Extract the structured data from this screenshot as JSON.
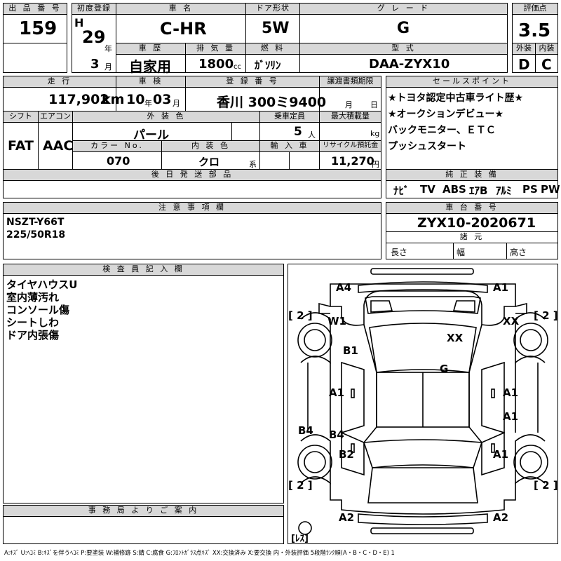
{
  "header": {
    "lot_no_label": "出 品 番 号",
    "lot_no": "159",
    "first_reg_label": "初度登録",
    "era": "H",
    "year": "29",
    "year_unit": "年",
    "month": "3",
    "month_unit": "月",
    "car_name_label": "車 名",
    "car_name": "C-HR",
    "door_label": "ドア形状",
    "door": "5W",
    "grade_label": "グ レ ー ド",
    "grade": "G",
    "score_label": "評価点",
    "score": "3.5",
    "history_label": "車 歴",
    "history": "自家用",
    "displacement_label": "排 気 量",
    "displacement": "1800",
    "displacement_unit": "cc",
    "fuel_label": "燃 料",
    "fuel": "ｶﾞｿﾘﾝ",
    "model_label": "型 式",
    "model": "DAA-ZYX10",
    "ext_label": "外装",
    "ext": "D",
    "int_label": "内装",
    "int": "C"
  },
  "row2": {
    "mileage_label": "走 行",
    "mileage": "117,902",
    "mileage_unit": "km",
    "inspection_label": "車 検",
    "insp_year": "10",
    "insp_year_unit": "年",
    "insp_month": "03",
    "insp_month_unit": "月",
    "plate_label": "登 録 番 号",
    "plate": "香川 300ミ9400",
    "transfer_label": "譲渡書類期限",
    "transfer_month": "月",
    "transfer_day": "日",
    "shift_label": "シフト",
    "shift": "FAT",
    "ac_label": "エアコン",
    "ac": "AAC",
    "color_label": "外 装 色",
    "color": "パール",
    "capacity_label": "乗車定員",
    "capacity": "5",
    "capacity_unit": "人",
    "load_label": "最大積載量",
    "load_unit": "kg",
    "color_no_label": "カラー No.",
    "color_no": "070",
    "int_color_label": "内 装 色",
    "int_color": "クロ",
    "int_color_unit": "系",
    "import_label": "輸 入 車",
    "recycle_label": "リサイクル預託金",
    "recycle": "11,270",
    "recycle_unit": "円",
    "later_label": "後 日 発 送 部 品"
  },
  "sales": {
    "label": "セールスポイント",
    "items": [
      "★トヨタ認定中古車ライト歴★",
      "★オークションデビュー★",
      "バックモニター、ＥＴＣ",
      "プッシュスタート"
    ]
  },
  "equipment": {
    "label": "純 正 装 備",
    "items": [
      "ﾅﾋﾞ",
      "TV",
      "ABS",
      "ｴｱB",
      "ｱﾙﾐ",
      "PS",
      "PW"
    ]
  },
  "notes": {
    "label": "注 意 事 項 欄",
    "lines": [
      "NSZT-Y66T",
      "225/50R18"
    ]
  },
  "chassis": {
    "label": "車 台 番 号",
    "number": "ZYX10-2020671",
    "dims_label": "諸 元",
    "length": "長さ",
    "width": "幅",
    "height": "高さ"
  },
  "inspector": {
    "label": "検 査 員 記 入 欄",
    "lines": [
      "タイヤハウスU",
      "室内薄汚れ",
      "コンソール傷",
      "シートしわ",
      "ドア内張傷"
    ]
  },
  "office": {
    "label": "事 務 局 よ り ご 案 内"
  },
  "diagram": {
    "marks": {
      "a4": "A4",
      "a1_top": "A1",
      "w1": "W1",
      "xx_right": "XX",
      "xx_center": "XX",
      "b1": "B1",
      "g": "G",
      "a1_left": "A1",
      "a1_right": "A1",
      "a1_mid_right": "A1",
      "b4_left": "B4",
      "b4_inner": "B4",
      "b2": "B2",
      "a1_low_right": "A1",
      "a2_left": "A2",
      "a2_right": "A2"
    },
    "tire_tl": "[ 2 ]",
    "tire_tr": "[ 2 ]",
    "tire_bl": "[ 2 ]",
    "tire_br": "[ 2 ]",
    "spare": "[ﾚｽ]"
  },
  "legend": "A:ｷｽﾞ U:ﾍｺﾐ B:ｷｽﾞを伴うﾍｺﾐ P:要塗装 W:補修跡 S:錆 C:腐食 G:ﾌﾛﾝﾄｶﾞﾗｽ点ｷｽﾞ XX:交換済み X:要交換 内・外装評価 5段階ﾗﾝｸ順(A・B・C・D・E) 1"
}
